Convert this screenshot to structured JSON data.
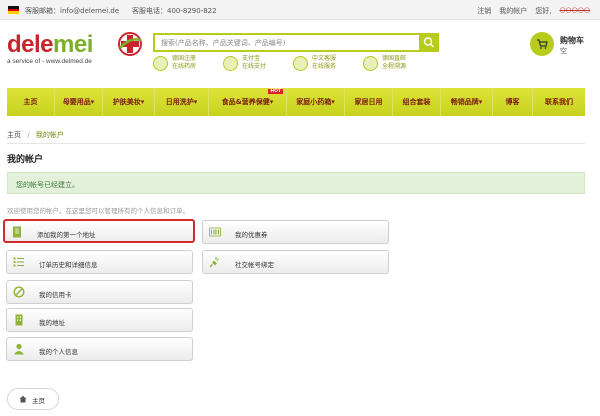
{
  "topbar": {
    "email": "客服邮箱：info@delemei.de",
    "phone": "客服电话：400-8290-822",
    "links": [
      "注销",
      "我的帐户",
      "您好,"
    ],
    "username": "○○○○○"
  },
  "logo": {
    "text_red": "dele",
    "text_green": "mei",
    "sub": "a service of - www.delmed.de"
  },
  "search": {
    "placeholder": "搜索(产品名称、产品关键词、产品编号)"
  },
  "features": [
    {
      "line1": "德国注册",
      "line2": "在线药房"
    },
    {
      "line1": "支付宝",
      "line2": "在线支付"
    },
    {
      "line1": "中文客服",
      "line2": "在线服务"
    },
    {
      "line1": "德国直邮",
      "line2": "全程溯源"
    }
  ],
  "cart": {
    "title": "购物车",
    "status": "空"
  },
  "nav": {
    "items": [
      {
        "label": "主页"
      },
      {
        "label": "母婴用品▾"
      },
      {
        "label": "护肤美妆▾"
      },
      {
        "label": "日用洗护▾"
      },
      {
        "label": "食品&营养保健▾",
        "hot": "HOT"
      },
      {
        "label": "家庭小药箱▾"
      },
      {
        "label": "家居日用"
      },
      {
        "label": "组合套装"
      },
      {
        "label": "畅销品牌▾"
      },
      {
        "label": "博客"
      },
      {
        "label": "联系我们"
      }
    ]
  },
  "breadcrumb": {
    "home": "主页",
    "sep": "/",
    "current": "我的帐户"
  },
  "page": {
    "title": "我的帐户",
    "alert": "您的帐号已经建立。",
    "welcome": "欢迎使用您的帐户。在这里您可以管理所有的个人信息和订单。"
  },
  "account": {
    "left": [
      {
        "label": "添加我的第一个地址"
      },
      {
        "label": "订单历史和详细信息"
      },
      {
        "label": "我的信用卡"
      },
      {
        "label": "我的地址"
      },
      {
        "label": "我的个人信息"
      }
    ],
    "right": [
      {
        "label": "我的优惠券"
      },
      {
        "label": "社交帐号绑定"
      }
    ]
  },
  "footer_button": {
    "label": "主页"
  },
  "colors": {
    "accent": "#b8cc1c",
    "nav_text": "#7a1a10",
    "logo_red": "#c8262c",
    "logo_green": "#7ab02a",
    "alert_bg": "#e3f1da",
    "highlight": "#d02b2b"
  }
}
